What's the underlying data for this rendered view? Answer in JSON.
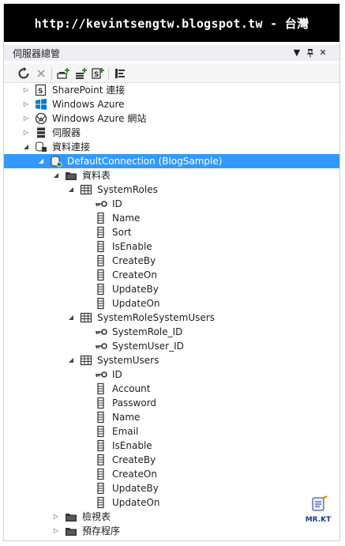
{
  "banner": {
    "text": "http://kevintsengtw.blogspot.tw - 台灣"
  },
  "window": {
    "title": "伺服器總管"
  },
  "title_controls": {
    "dropdown": "▼",
    "pin": "ᛘ",
    "close": "✕"
  },
  "toolbar": {
    "icons": [
      "refresh-icon",
      "stop-icon",
      "connect-server-icon",
      "add-connection-icon",
      "sharepoint-connection-icon",
      "properties-icon"
    ]
  },
  "tree": [
    {
      "level": 0,
      "expand": "collapsed",
      "icon": "sharepoint-icon",
      "label": "SharePoint 連接"
    },
    {
      "level": 0,
      "expand": "collapsed",
      "icon": "windows-azure-icon",
      "label": "Windows Azure"
    },
    {
      "level": 0,
      "expand": "collapsed",
      "icon": "azure-website-icon",
      "label": "Windows Azure 網站"
    },
    {
      "level": 0,
      "expand": "collapsed",
      "icon": "server-icon",
      "label": "伺服器"
    },
    {
      "level": 0,
      "expand": "expanded",
      "icon": "data-connections-icon",
      "label": "資料連接"
    },
    {
      "level": 1,
      "expand": "expanded",
      "icon": "database-icon",
      "label": "DefaultConnection (BlogSample)",
      "selected": true
    },
    {
      "level": 2,
      "expand": "expanded",
      "icon": "folder-icon",
      "label": "資料表"
    },
    {
      "level": 3,
      "expand": "expanded",
      "icon": "table-icon",
      "label": "SystemRoles"
    },
    {
      "level": 4,
      "expand": "none",
      "icon": "key-icon",
      "label": "ID"
    },
    {
      "level": 4,
      "expand": "none",
      "icon": "column-icon",
      "label": "Name"
    },
    {
      "level": 4,
      "expand": "none",
      "icon": "column-icon",
      "label": "Sort"
    },
    {
      "level": 4,
      "expand": "none",
      "icon": "column-icon",
      "label": "IsEnable"
    },
    {
      "level": 4,
      "expand": "none",
      "icon": "column-icon",
      "label": "CreateBy"
    },
    {
      "level": 4,
      "expand": "none",
      "icon": "column-icon",
      "label": "CreateOn"
    },
    {
      "level": 4,
      "expand": "none",
      "icon": "column-icon",
      "label": "UpdateBy"
    },
    {
      "level": 4,
      "expand": "none",
      "icon": "column-icon",
      "label": "UpdateOn"
    },
    {
      "level": 3,
      "expand": "expanded",
      "icon": "table-icon",
      "label": "SystemRoleSystemUsers"
    },
    {
      "level": 4,
      "expand": "none",
      "icon": "key-icon",
      "label": "SystemRole_ID"
    },
    {
      "level": 4,
      "expand": "none",
      "icon": "key-icon",
      "label": "SystemUser_ID"
    },
    {
      "level": 3,
      "expand": "expanded",
      "icon": "table-icon",
      "label": "SystemUsers"
    },
    {
      "level": 4,
      "expand": "none",
      "icon": "key-icon",
      "label": "ID"
    },
    {
      "level": 4,
      "expand": "none",
      "icon": "column-icon",
      "label": "Account"
    },
    {
      "level": 4,
      "expand": "none",
      "icon": "column-icon",
      "label": "Password"
    },
    {
      "level": 4,
      "expand": "none",
      "icon": "column-icon",
      "label": "Name"
    },
    {
      "level": 4,
      "expand": "none",
      "icon": "column-icon",
      "label": "Email"
    },
    {
      "level": 4,
      "expand": "none",
      "icon": "column-icon",
      "label": "IsEnable"
    },
    {
      "level": 4,
      "expand": "none",
      "icon": "column-icon",
      "label": "CreateBy"
    },
    {
      "level": 4,
      "expand": "none",
      "icon": "column-icon",
      "label": "CreateOn"
    },
    {
      "level": 4,
      "expand": "none",
      "icon": "column-icon",
      "label": "UpdateBy"
    },
    {
      "level": 4,
      "expand": "none",
      "icon": "column-icon",
      "label": "UpdateOn"
    },
    {
      "level": 2,
      "expand": "collapsed",
      "icon": "folder-icon",
      "label": "檢視表"
    },
    {
      "level": 2,
      "expand": "collapsed",
      "icon": "folder-icon",
      "label": "預存程序"
    }
  ],
  "watermark": {
    "text": "MR.KT"
  },
  "colors": {
    "selection": "#3399ff",
    "titlebar": "#eeeef2",
    "banner_bg": "#000000"
  }
}
